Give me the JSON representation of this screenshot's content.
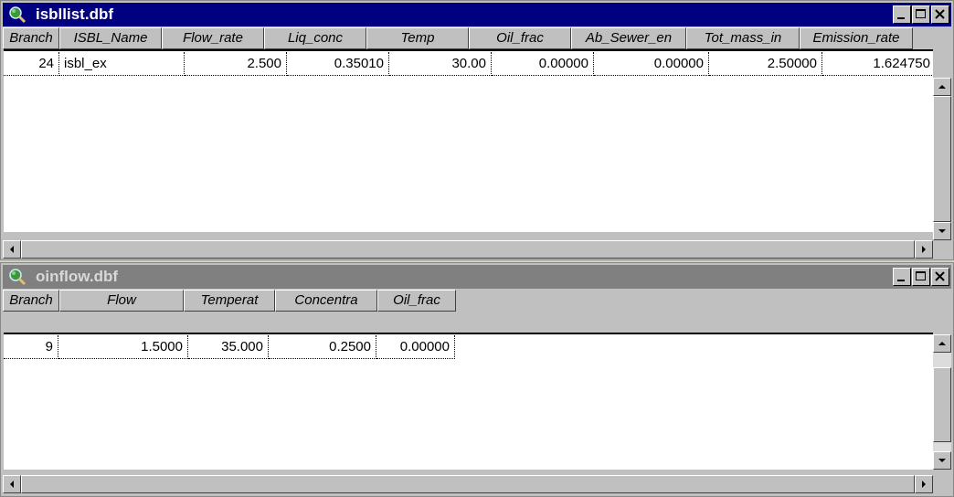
{
  "colors": {
    "active_title": "#000080",
    "inactive_title": "#808080",
    "window_face": "#c0c0c0",
    "grid_bg": "#ffffff"
  },
  "windows": [
    {
      "title": "isbllist.dbf",
      "active": true,
      "icon": "globe-magnifier-icon",
      "columns": [
        "Branch",
        "ISBL_Name",
        "Flow_rate",
        "Liq_conc",
        "Temp",
        "Oil_frac",
        "Ab_Sewer_en",
        "Tot_mass_in",
        "Emission_rate"
      ],
      "rows": [
        [
          "24",
          "isbl_ex",
          "2.500",
          "0.35010",
          "30.00",
          "0.00000",
          "0.00000",
          "2.50000",
          "1.624750"
        ]
      ]
    },
    {
      "title": "oinflow.dbf",
      "active": false,
      "icon": "globe-magnifier-icon",
      "columns": [
        "Branch",
        "Flow",
        "Temperat",
        "Concentra",
        "Oil_frac"
      ],
      "rows": [
        [
          "9",
          "1.5000",
          "35.000",
          "0.2500",
          "0.00000"
        ]
      ]
    }
  ]
}
